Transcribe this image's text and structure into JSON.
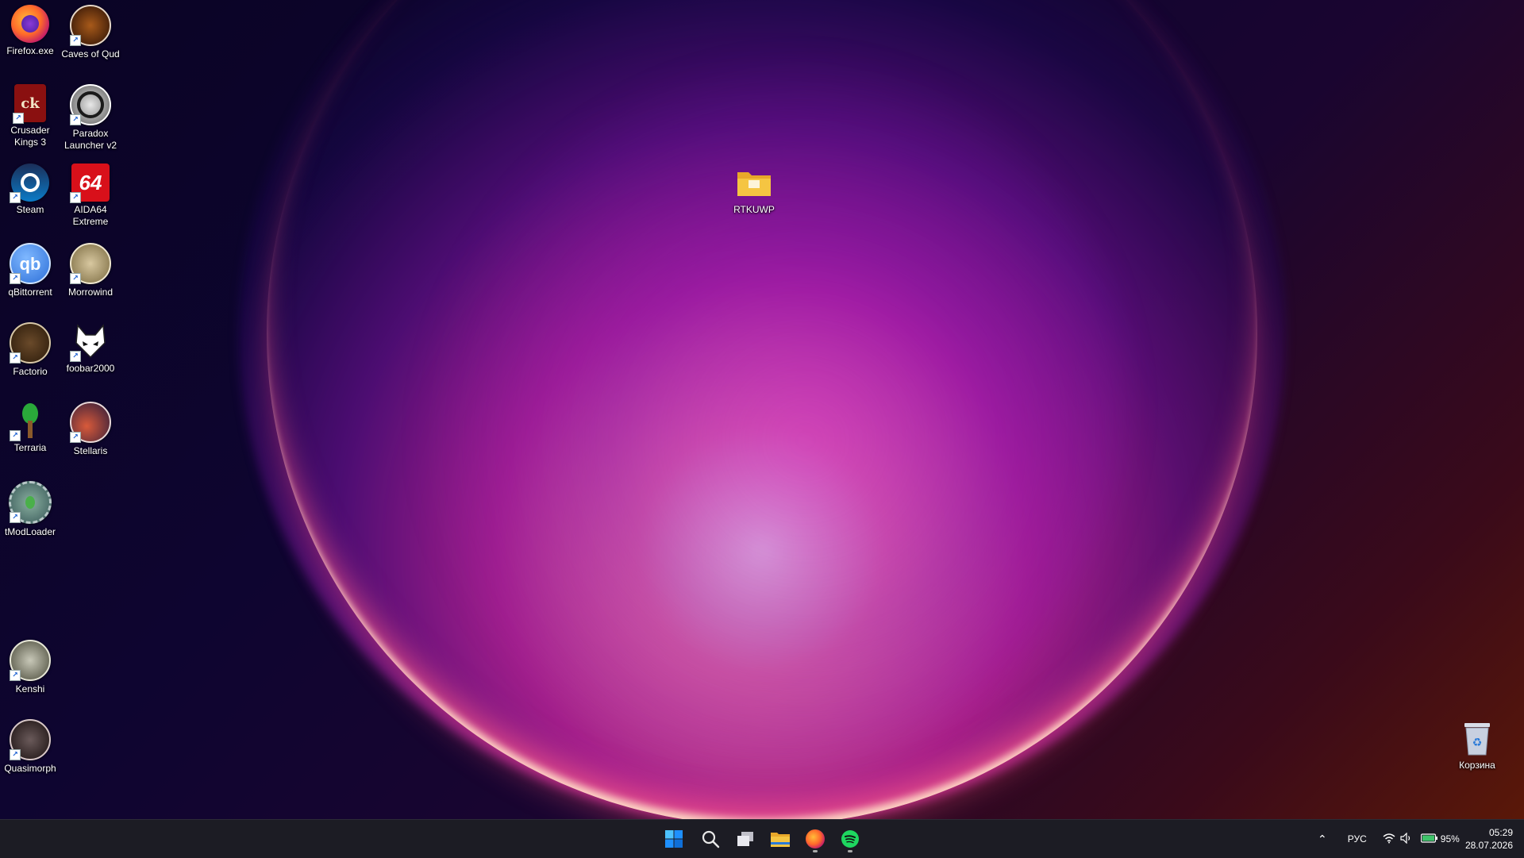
{
  "desktop": {
    "icons": [
      {
        "name": "firefox",
        "label": "Firefox.exe",
        "shortcut": false
      },
      {
        "name": "caves-of-qud",
        "label": "Caves of Qud",
        "shortcut": true
      },
      {
        "name": "crusader-kings-3",
        "label": "Crusader Kings 3",
        "shortcut": true
      },
      {
        "name": "paradox-launcher",
        "label": "Paradox Launcher v2",
        "shortcut": true
      },
      {
        "name": "steam",
        "label": "Steam",
        "shortcut": true
      },
      {
        "name": "aida64",
        "label": "AIDA64 Extreme",
        "shortcut": true
      },
      {
        "name": "qbittorrent",
        "label": "qBittorrent",
        "shortcut": true
      },
      {
        "name": "morrowind",
        "label": "Morrowind",
        "shortcut": true
      },
      {
        "name": "factorio",
        "label": "Factorio",
        "shortcut": true
      },
      {
        "name": "foobar2000",
        "label": "foobar2000",
        "shortcut": true
      },
      {
        "name": "terraria",
        "label": "Terraria",
        "shortcut": true
      },
      {
        "name": "stellaris",
        "label": "Stellaris",
        "shortcut": true
      },
      {
        "name": "tmodloader",
        "label": "tModLoader",
        "shortcut": true
      },
      {
        "name": "kenshi",
        "label": "Kenshi",
        "shortcut": true
      },
      {
        "name": "quasimorph",
        "label": "Quasimorph",
        "shortcut": true
      },
      {
        "name": "rtkuwp-folder",
        "label": "RTKUWP",
        "shortcut": false
      },
      {
        "name": "recycle-bin",
        "label": "Корзина",
        "shortcut": false
      }
    ],
    "icon_text": {
      "crusader_kings": "ck",
      "qbittorrent": "qb",
      "aida64": "64"
    }
  },
  "taskbar": {
    "apps": [
      "start",
      "search",
      "task-view",
      "file-explorer",
      "firefox",
      "spotify"
    ],
    "tray": {
      "language": "РУС",
      "battery": "95%"
    },
    "clock": {
      "time": "05:29",
      "date": "28.07.2026"
    }
  },
  "colors": {
    "taskbar_bg": "#1c1c24",
    "windows_blue": "#1e90ff",
    "spotify_green": "#1ed760",
    "folder_yellow": "#f5c542"
  }
}
